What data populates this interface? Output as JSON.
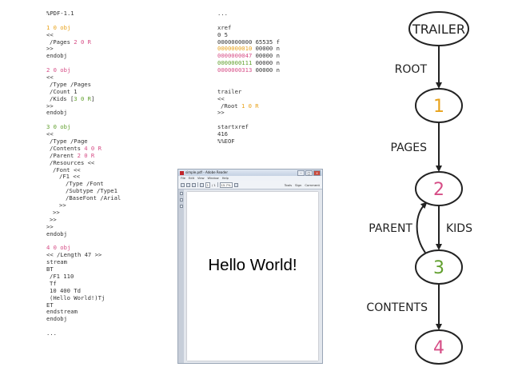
{
  "left_code": [
    {
      "parts": [
        {
          "t": "%PDF-1.1",
          "c": ""
        }
      ],
      "indent": 0
    },
    {
      "parts": [],
      "indent": 0
    },
    {
      "parts": [
        {
          "t": "1 0 obj",
          "c": "orange"
        }
      ],
      "indent": 0
    },
    {
      "parts": [
        {
          "t": "<<",
          "c": ""
        }
      ],
      "indent": 0
    },
    {
      "parts": [
        {
          "t": "/Pages ",
          "c": ""
        },
        {
          "t": "2 0 R",
          "c": "pink"
        }
      ],
      "indent": 1
    },
    {
      "parts": [
        {
          "t": ">>",
          "c": ""
        }
      ],
      "indent": 0
    },
    {
      "parts": [
        {
          "t": "endobj",
          "c": ""
        }
      ],
      "indent": 0
    },
    {
      "parts": [],
      "indent": 0
    },
    {
      "parts": [
        {
          "t": "2 0 obj",
          "c": "pink"
        }
      ],
      "indent": 0
    },
    {
      "parts": [
        {
          "t": "<<",
          "c": ""
        }
      ],
      "indent": 0
    },
    {
      "parts": [
        {
          "t": "/Type /Pages",
          "c": ""
        }
      ],
      "indent": 1
    },
    {
      "parts": [
        {
          "t": "/Count 1",
          "c": ""
        }
      ],
      "indent": 1
    },
    {
      "parts": [
        {
          "t": "/Kids [",
          "c": ""
        },
        {
          "t": "3 0 R",
          "c": "green"
        },
        {
          "t": "]",
          "c": ""
        }
      ],
      "indent": 1
    },
    {
      "parts": [
        {
          "t": ">>",
          "c": ""
        }
      ],
      "indent": 0
    },
    {
      "parts": [
        {
          "t": "endobj",
          "c": ""
        }
      ],
      "indent": 0
    },
    {
      "parts": [],
      "indent": 0
    },
    {
      "parts": [
        {
          "t": "3 0 obj",
          "c": "green"
        }
      ],
      "indent": 0
    },
    {
      "parts": [
        {
          "t": "<<",
          "c": ""
        }
      ],
      "indent": 0
    },
    {
      "parts": [
        {
          "t": "/Type /Page",
          "c": ""
        }
      ],
      "indent": 1
    },
    {
      "parts": [
        {
          "t": "/Contents ",
          "c": ""
        },
        {
          "t": "4 0 R",
          "c": "pink"
        }
      ],
      "indent": 1
    },
    {
      "parts": [
        {
          "t": "/Parent ",
          "c": ""
        },
        {
          "t": "2 0 R",
          "c": "pink"
        }
      ],
      "indent": 1
    },
    {
      "parts": [
        {
          "t": "/Resources <<",
          "c": ""
        }
      ],
      "indent": 1
    },
    {
      "parts": [
        {
          "t": "/Font <<",
          "c": ""
        }
      ],
      "indent": 2
    },
    {
      "parts": [
        {
          "t": "/F1 <<",
          "c": ""
        }
      ],
      "indent": 3
    },
    {
      "parts": [
        {
          "t": "/Type /Font",
          "c": ""
        }
      ],
      "indent": 4
    },
    {
      "parts": [
        {
          "t": "/Subtype /Type1",
          "c": ""
        }
      ],
      "indent": 4
    },
    {
      "parts": [
        {
          "t": "/BaseFont /Arial",
          "c": ""
        }
      ],
      "indent": 4
    },
    {
      "parts": [
        {
          "t": ">>",
          "c": ""
        }
      ],
      "indent": 3
    },
    {
      "parts": [
        {
          "t": ">>",
          "c": ""
        }
      ],
      "indent": 2
    },
    {
      "parts": [
        {
          "t": ">>",
          "c": ""
        }
      ],
      "indent": 1
    },
    {
      "parts": [
        {
          "t": ">>",
          "c": ""
        }
      ],
      "indent": 0
    },
    {
      "parts": [
        {
          "t": "endobj",
          "c": ""
        }
      ],
      "indent": 0
    },
    {
      "parts": [],
      "indent": 0
    },
    {
      "parts": [
        {
          "t": "4 0 obj",
          "c": "pink"
        }
      ],
      "indent": 0
    },
    {
      "parts": [
        {
          "t": "<< /Length 47 >>",
          "c": ""
        }
      ],
      "indent": 0
    },
    {
      "parts": [
        {
          "t": "stream",
          "c": ""
        }
      ],
      "indent": 0
    },
    {
      "parts": [
        {
          "t": "BT",
          "c": ""
        }
      ],
      "indent": 0
    },
    {
      "parts": [
        {
          "t": "/F1 110",
          "c": ""
        }
      ],
      "indent": 1
    },
    {
      "parts": [
        {
          "t": "Tf",
          "c": ""
        }
      ],
      "indent": 1
    },
    {
      "parts": [
        {
          "t": "10 400 Td",
          "c": ""
        }
      ],
      "indent": 1
    },
    {
      "parts": [
        {
          "t": "(Hello World!)Tj",
          "c": ""
        }
      ],
      "indent": 1
    },
    {
      "parts": [
        {
          "t": "ET",
          "c": ""
        }
      ],
      "indent": 0
    },
    {
      "parts": [
        {
          "t": "endstream",
          "c": ""
        }
      ],
      "indent": 0
    },
    {
      "parts": [
        {
          "t": "endobj",
          "c": ""
        }
      ],
      "indent": 0
    },
    {
      "parts": [],
      "indent": 0
    },
    {
      "parts": [
        {
          "t": "...",
          "c": ""
        }
      ],
      "indent": 0
    }
  ],
  "right_code": [
    {
      "parts": [
        {
          "t": "...",
          "c": ""
        }
      ],
      "indent": 0
    },
    {
      "parts": [],
      "indent": 0
    },
    {
      "parts": [
        {
          "t": "xref",
          "c": ""
        }
      ],
      "indent": 0
    },
    {
      "parts": [
        {
          "t": "0 5",
          "c": ""
        }
      ],
      "indent": 0
    },
    {
      "parts": [
        {
          "t": "0000000000 65535 f",
          "c": ""
        }
      ],
      "indent": 0
    },
    {
      "parts": [
        {
          "t": "0000000010",
          "c": "orange"
        },
        {
          "t": " 00000 n",
          "c": ""
        }
      ],
      "indent": 0
    },
    {
      "parts": [
        {
          "t": "0000000047",
          "c": "pink"
        },
        {
          "t": " 00000 n",
          "c": ""
        }
      ],
      "indent": 0
    },
    {
      "parts": [
        {
          "t": "0000000111",
          "c": "green"
        },
        {
          "t": " 00000 n",
          "c": ""
        }
      ],
      "indent": 0
    },
    {
      "parts": [
        {
          "t": "0000000313",
          "c": "pink"
        },
        {
          "t": " 00000 n",
          "c": ""
        }
      ],
      "indent": 0
    },
    {
      "parts": [],
      "indent": 0
    },
    {
      "parts": [],
      "indent": 0
    },
    {
      "parts": [
        {
          "t": "trailer",
          "c": ""
        }
      ],
      "indent": 0
    },
    {
      "parts": [
        {
          "t": "<<",
          "c": ""
        }
      ],
      "indent": 0
    },
    {
      "parts": [
        {
          "t": "/Root ",
          "c": ""
        },
        {
          "t": "1 0 R",
          "c": "orange"
        }
      ],
      "indent": 1
    },
    {
      "parts": [
        {
          "t": ">>",
          "c": ""
        }
      ],
      "indent": 0
    },
    {
      "parts": [],
      "indent": 0
    },
    {
      "parts": [
        {
          "t": "startxref",
          "c": ""
        }
      ],
      "indent": 0
    },
    {
      "parts": [
        {
          "t": "416",
          "c": ""
        }
      ],
      "indent": 0
    },
    {
      "parts": [
        {
          "t": "%%EOF",
          "c": ""
        }
      ],
      "indent": 0
    }
  ],
  "reader": {
    "title": "simple.pdf - Adobe Reader",
    "menu": [
      "File",
      "Edit",
      "View",
      "Window",
      "Help"
    ],
    "page_num": "1",
    "page_total": "/ 1",
    "zoom": "15.7%",
    "toolbar_right": [
      "Tools",
      "Sign",
      "Comment"
    ],
    "content_text": "Hello World!"
  },
  "diagram": {
    "nodes": [
      {
        "id": "trailer",
        "label": "TRAILER",
        "color": "#222222"
      },
      {
        "id": "n1",
        "label": "1",
        "color": "#e8a21b"
      },
      {
        "id": "n2",
        "label": "2",
        "color": "#d64d86"
      },
      {
        "id": "n3",
        "label": "3",
        "color": "#62a02f"
      },
      {
        "id": "n4",
        "label": "4",
        "color": "#d64d86"
      }
    ],
    "edges": {
      "root": "ROOT",
      "pages": "PAGES",
      "parent": "PARENT",
      "kids": "KIDS",
      "contents": "CONTENTS"
    }
  },
  "colors": {
    "orange": "#e8a21b",
    "pink": "#d64d86",
    "green": "#62a02f",
    "ink": "#222222"
  }
}
